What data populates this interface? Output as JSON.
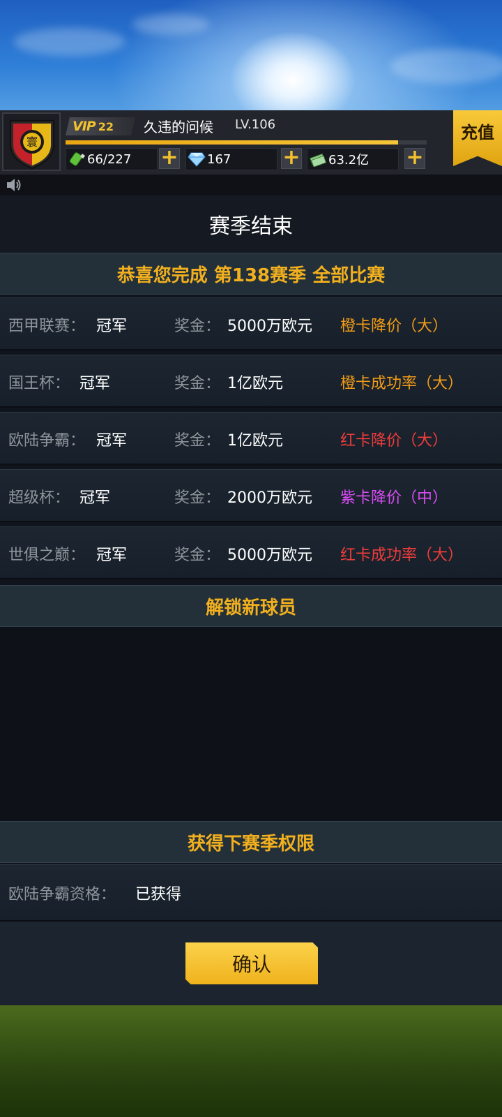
{
  "header": {
    "vip_label": "VIP",
    "vip_level": "22",
    "player_name": "久违的问候",
    "player_level": "LV.106",
    "xp_fraction": 0.92,
    "stamina": "66/227",
    "diamonds": "167",
    "coins": "63.2亿",
    "recharge_label": "充值"
  },
  "panel": {
    "title": "赛季结束",
    "congrats_prefix": "恭喜您完成 第",
    "season_number": "138",
    "congrats_suffix": "赛季 全部比赛",
    "results": [
      {
        "competition": "西甲联赛：",
        "rank": "冠军",
        "prize_label": "奖金：",
        "prize": "5000万欧元",
        "reward": "橙卡降价（大）",
        "reward_color": "#f29b17"
      },
      {
        "competition": "国王杯：",
        "rank": "冠军",
        "prize_label": "奖金：",
        "prize": "1亿欧元",
        "reward": "橙卡成功率（大）",
        "reward_color": "#f29b17"
      },
      {
        "competition": "欧陆争霸：",
        "rank": "冠军",
        "prize_label": "奖金：",
        "prize": "1亿欧元",
        "reward": "红卡降价（大）",
        "reward_color": "#f03c3c"
      },
      {
        "competition": "超级杯：",
        "rank": "冠军",
        "prize_label": "奖金：",
        "prize": "2000万欧元",
        "reward": "紫卡降价（中）",
        "reward_color": "#d94cf5"
      },
      {
        "competition": "世俱之巅：",
        "rank": "冠军",
        "prize_label": "奖金：",
        "prize": "5000万欧元",
        "reward": "红卡成功率（大）",
        "reward_color": "#f03c3c"
      }
    ],
    "unlock_title": "解锁新球员",
    "next_season_title": "获得下赛季权限",
    "qualification_label": "欧陆争霸资格：",
    "qualification_value": "已获得",
    "confirm_label": "确认"
  },
  "colors": {
    "accent_gold": "#f2b01e",
    "season_number": "#42d6a4"
  },
  "icons": [
    "club-crest-icon",
    "stamina-bottle-icon",
    "diamond-icon",
    "cash-icon",
    "plus-icon",
    "speaker-icon"
  ]
}
